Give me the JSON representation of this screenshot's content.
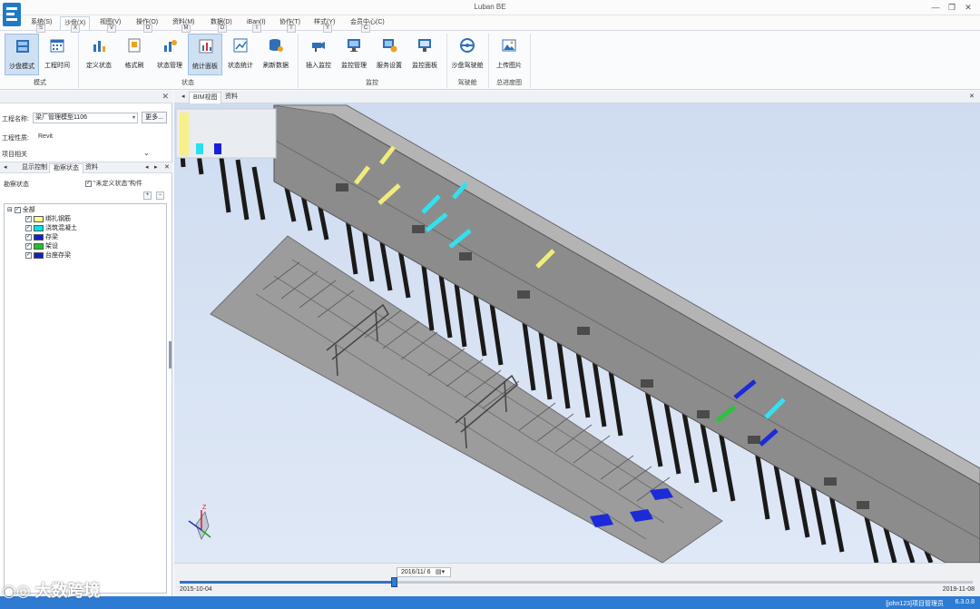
{
  "window": {
    "title": "Luban BE",
    "controls": {
      "minimize": "—",
      "restore": "❐",
      "close": "✕"
    }
  },
  "menu": {
    "items": [
      {
        "label": "系统(S)",
        "hotkey": "S"
      },
      {
        "label": "沙盘(X)",
        "hotkey": "X",
        "active": true
      },
      {
        "label": "视图(V)",
        "hotkey": "V"
      },
      {
        "label": "操作(O)",
        "hotkey": "O"
      },
      {
        "label": "资料(M)",
        "hotkey": "M"
      },
      {
        "label": "数据(D)",
        "hotkey": "D"
      },
      {
        "label": "iBan(I)",
        "hotkey": "I"
      },
      {
        "label": "协作(T)",
        "hotkey": "T"
      },
      {
        "label": "样式(Y)",
        "hotkey": "Y"
      },
      {
        "label": "会员中心(C)",
        "hotkey": "C"
      }
    ]
  },
  "ribbon": {
    "buttons": [
      {
        "label": "沙盘模式",
        "icon": "sandbox-mode-icon",
        "active": true
      },
      {
        "label": "工程时间",
        "icon": "calendar-icon"
      },
      {
        "label": "定义状态",
        "icon": "define-status-icon"
      },
      {
        "label": "格式刷",
        "icon": "format-brush-icon"
      },
      {
        "label": "状态管理",
        "icon": "status-manage-icon"
      },
      {
        "label": "统计面板",
        "icon": "stats-panel-icon",
        "active": true
      },
      {
        "label": "状态统计",
        "icon": "status-stats-icon"
      },
      {
        "label": "刷新数据",
        "icon": "refresh-data-icon"
      },
      {
        "label": "插入监控",
        "icon": "insert-camera-icon"
      },
      {
        "label": "监控管理",
        "icon": "monitor-manage-icon"
      },
      {
        "label": "服务设置",
        "icon": "service-settings-icon"
      },
      {
        "label": "监控面板",
        "icon": "monitor-panel-icon"
      },
      {
        "label": "沙盘驾驶舱",
        "icon": "steering-wheel-icon"
      },
      {
        "label": "上传图片",
        "icon": "upload-image-icon"
      }
    ],
    "groups": [
      "模式",
      "状态",
      "监控",
      "驾驶舱",
      "总进度图"
    ]
  },
  "left_panel": {
    "project_name_label": "工程名称:",
    "project_name_value": "梁厂管理模型1106",
    "more_button": "更多...",
    "project_type_label": "工程性质:",
    "project_type_value": "Revit",
    "related_label": "项目相关",
    "tabs": [
      "显示控制",
      "勘察状态",
      "资料"
    ],
    "active_tab": 1,
    "progress_label": "勘察状态",
    "undefined_check_label": "\"未定义状态\"构件",
    "tree": {
      "root": "全部",
      "items": [
        {
          "label": "绑扎钢筋",
          "color": "#ffff80"
        },
        {
          "label": "浇筑混凝土",
          "color": "#00e5e5"
        },
        {
          "label": "存梁",
          "color": "#1020d0"
        },
        {
          "label": "架设",
          "color": "#20c030"
        },
        {
          "label": "台座存梁",
          "color": "#1020c0"
        }
      ]
    }
  },
  "viewport": {
    "tabs": [
      "BIM视图",
      "资料"
    ],
    "active_tab": 0,
    "legend_colors": [
      "#f5f08a",
      "#27e1ee",
      "#1a1fd8"
    ],
    "axis_label": "Z"
  },
  "timeline": {
    "current_date": "2016/11/ 6",
    "start_date": "2015-10-04",
    "end_date": "2019-11-08",
    "progress": 0.27
  },
  "statusbar": {
    "user": "[john123]项目管理员",
    "version": "6.3.0.8"
  },
  "watermark": "大数跨境"
}
